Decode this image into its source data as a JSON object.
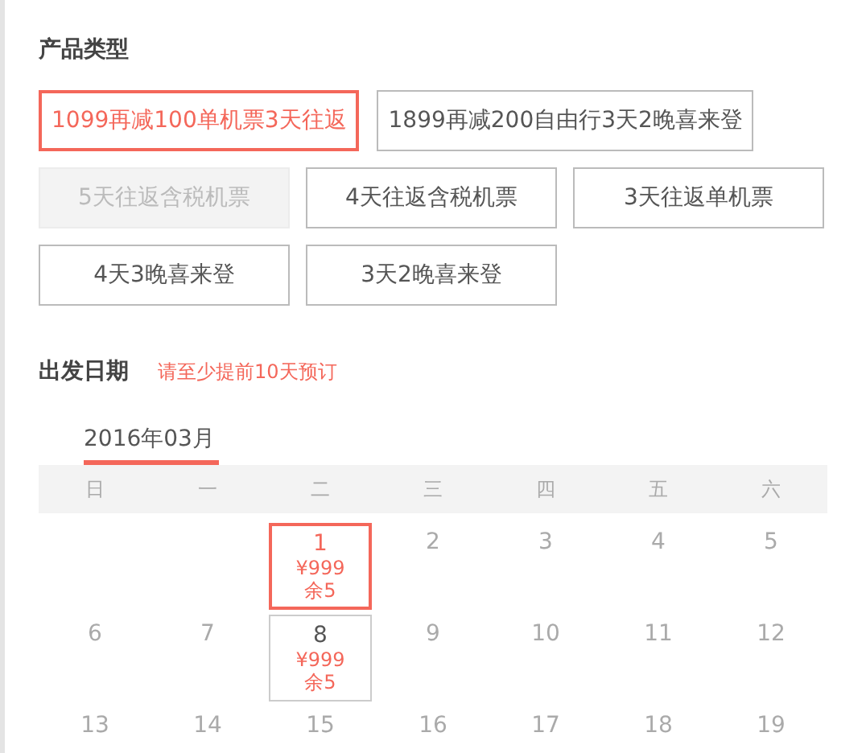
{
  "product_section": {
    "title": "产品类型",
    "options": [
      {
        "label": "1099再减100单机票3天往返",
        "selected": true,
        "disabled": false
      },
      {
        "label": "1899再减200自由行3天2晚喜来登",
        "selected": false,
        "disabled": false
      },
      {
        "label": "5天往返含税机票",
        "selected": false,
        "disabled": true
      },
      {
        "label": "4天往返含税机票",
        "selected": false,
        "disabled": false
      },
      {
        "label": "3天往返单机票",
        "selected": false,
        "disabled": false
      },
      {
        "label": "4天3晚喜来登",
        "selected": false,
        "disabled": false
      },
      {
        "label": "3天2晚喜来登",
        "selected": false,
        "disabled": false
      }
    ]
  },
  "date_section": {
    "title": "出发日期",
    "notice": "请至少提前10天预订",
    "month": "2016年03月",
    "weekdays": [
      "日",
      "一",
      "二",
      "三",
      "四",
      "五",
      "六"
    ],
    "weeks": [
      [
        {
          "kind": "empty"
        },
        {
          "kind": "empty"
        },
        {
          "kind": "available",
          "day": "1",
          "price": "¥999",
          "stock": "余5",
          "selected": true
        },
        {
          "kind": "unavailable",
          "day": "2"
        },
        {
          "kind": "unavailable",
          "day": "3"
        },
        {
          "kind": "unavailable",
          "day": "4"
        },
        {
          "kind": "unavailable",
          "day": "5"
        }
      ],
      [
        {
          "kind": "unavailable",
          "day": "6"
        },
        {
          "kind": "unavailable",
          "day": "7"
        },
        {
          "kind": "available",
          "day": "8",
          "price": "¥999",
          "stock": "余5",
          "selected": false
        },
        {
          "kind": "unavailable",
          "day": "9"
        },
        {
          "kind": "unavailable",
          "day": "10"
        },
        {
          "kind": "unavailable",
          "day": "11"
        },
        {
          "kind": "unavailable",
          "day": "12"
        }
      ],
      [
        {
          "kind": "unavailable",
          "day": "13"
        },
        {
          "kind": "unavailable",
          "day": "14"
        },
        {
          "kind": "unavailable",
          "day": "15"
        },
        {
          "kind": "unavailable",
          "day": "16"
        },
        {
          "kind": "unavailable",
          "day": "17"
        },
        {
          "kind": "unavailable",
          "day": "18"
        },
        {
          "kind": "unavailable",
          "day": "19"
        }
      ]
    ]
  }
}
